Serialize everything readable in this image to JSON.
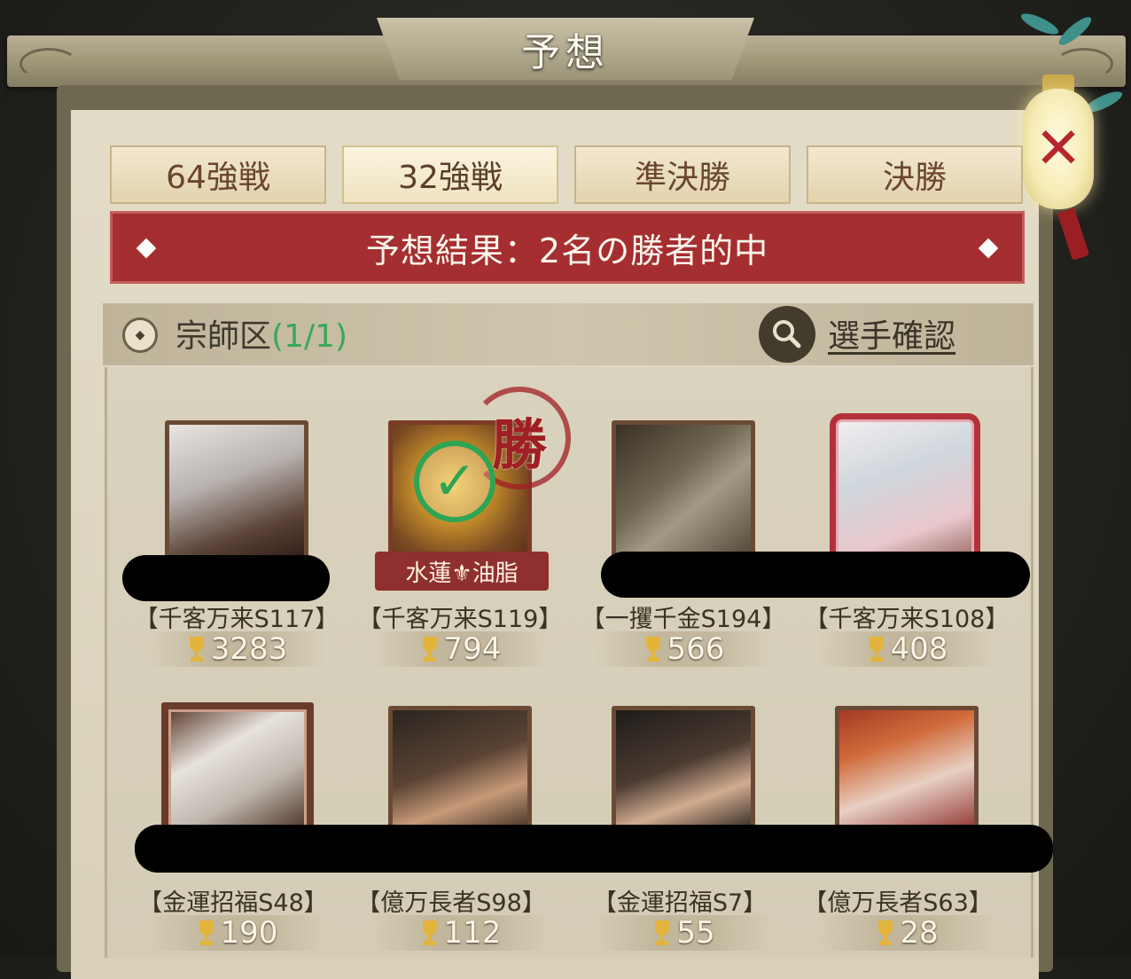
{
  "window": {
    "title": "予想"
  },
  "tabs": [
    {
      "label": "64強戦",
      "active": false
    },
    {
      "label": "32強戦",
      "active": true
    },
    {
      "label": "準決勝",
      "active": false
    },
    {
      "label": "決勝",
      "active": false
    }
  ],
  "banner": {
    "text": "予想結果：2名の勝者的中"
  },
  "section": {
    "label": "宗師区",
    "count": "(1/1)",
    "check_players": "選手確認"
  },
  "winner": {
    "stamp": "勝",
    "label": "水蓮⚜油脂"
  },
  "players": [
    {
      "server": "【千客万来S117】",
      "score": "3283"
    },
    {
      "server": "【千客万来S119】",
      "score": "794"
    },
    {
      "server": "【一攫千金S194】",
      "score": "566"
    },
    {
      "server": "【千客万来S108】",
      "score": "408"
    },
    {
      "server": "【金運招福S48】",
      "score": "190"
    },
    {
      "server": "【億万長者S98】",
      "score": "112"
    },
    {
      "server": "【金運招福S7】",
      "score": "55"
    },
    {
      "server": "【億万長者S63】",
      "score": "28"
    }
  ],
  "colors": {
    "banner": "#a52e31",
    "count_green": "#3aa85a",
    "check_green": "#2ea553"
  },
  "icons": [
    "close-icon",
    "search-icon",
    "coin-icon",
    "trophy-icon",
    "check-icon"
  ]
}
